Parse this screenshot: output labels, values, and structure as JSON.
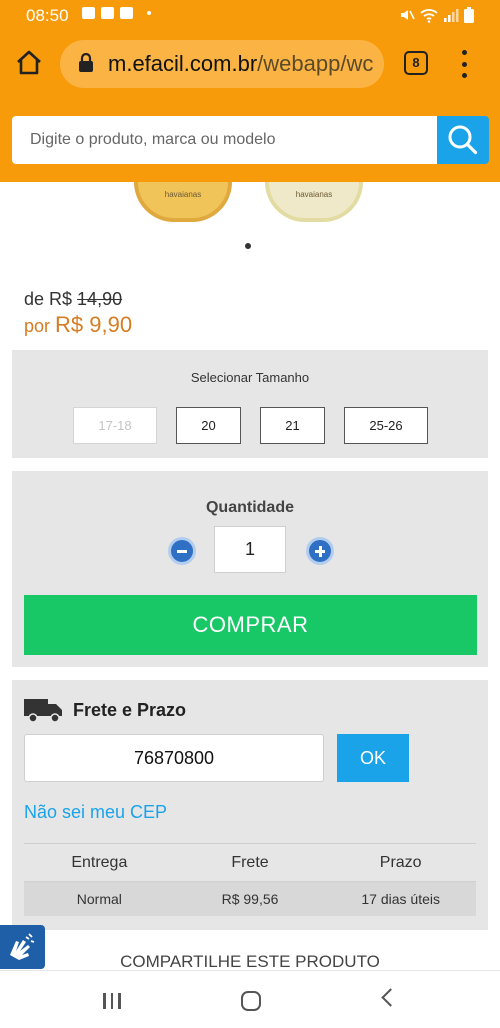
{
  "status_bar": {
    "time": "08:50"
  },
  "browser": {
    "url_host": "m.efacil.com.br",
    "url_path": "/webapp/wc",
    "tab_count": "8"
  },
  "search": {
    "placeholder": "Digite o produto, marca ou modelo"
  },
  "product_images": {
    "label_1": "havaianas",
    "label_2": "havaianas"
  },
  "price": {
    "old_prefix": "de R$ ",
    "old_value": "14,90",
    "new_prefix": "por ",
    "new_value": "R$ 9,90"
  },
  "sizes": {
    "title": "Selecionar Tamanho",
    "options": [
      {
        "label": "17-18",
        "available": false
      },
      {
        "label": "20",
        "available": true
      },
      {
        "label": "21",
        "available": true
      },
      {
        "label": "25-26",
        "available": true
      }
    ]
  },
  "quantity": {
    "title": "Quantidade",
    "value": "1",
    "buy_label": "COMPRAR"
  },
  "shipping": {
    "title": "Frete e Prazo",
    "cep_value": "76870800",
    "ok_label": "OK",
    "cep_link": "Não sei meu CEP",
    "columns": [
      "Entrega",
      "Frete",
      "Prazo"
    ],
    "rows": [
      {
        "entrega": "Normal",
        "frete": "R$ 99,56",
        "prazo": "17 dias úteis"
      }
    ]
  },
  "share": {
    "title": "COMPARTILHE ESTE PRODUTO"
  },
  "colors": {
    "brand_orange": "#f79b0b",
    "search_blue": "#1aa3e8",
    "buy_green": "#18c765",
    "price_orange": "#d67c22"
  }
}
